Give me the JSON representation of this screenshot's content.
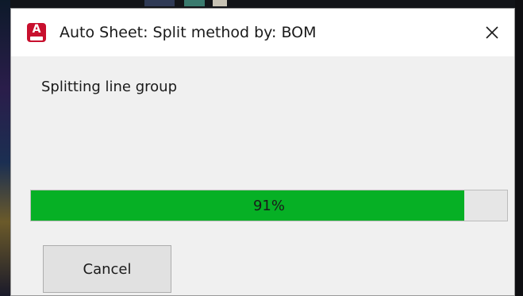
{
  "dialog": {
    "title": "Auto Sheet: Split method by: BOM",
    "app_icon_letter": "A",
    "app_icon": "autocad-app-icon",
    "close_icon": "close-icon",
    "status_text": "Splitting line group",
    "progress": {
      "percent": 91,
      "label": "91%",
      "fill_color": "#06b025",
      "track_color": "#e6e6e6"
    },
    "cancel_label": "Cancel"
  },
  "colors": {
    "app_icon_bg": "#c8102e",
    "dialog_bg": "#f0f0f0",
    "titlebar_bg": "#ffffff"
  }
}
